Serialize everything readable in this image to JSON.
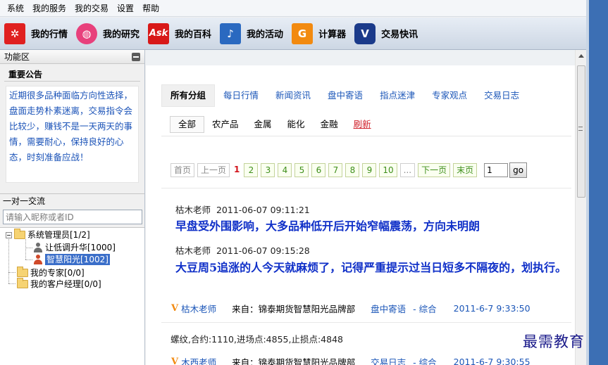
{
  "menu": [
    "系统",
    "我的服务",
    "我的交易",
    "设置",
    "帮助"
  ],
  "toolbar": [
    {
      "label": "我的行情",
      "icon": "flower-icon",
      "glyph": "✲"
    },
    {
      "label": "我的研究",
      "icon": "dribbble-icon",
      "glyph": "◍"
    },
    {
      "label": "我的百科",
      "icon": "ask-icon",
      "glyph": "Ask"
    },
    {
      "label": "我的活动",
      "icon": "music-note-icon",
      "glyph": "♪"
    },
    {
      "label": "计算器",
      "icon": "g-icon",
      "glyph": "G"
    },
    {
      "label": "交易快讯",
      "icon": "v-icon",
      "glyph": "V"
    }
  ],
  "left": {
    "panel_title": "功能区",
    "notice_title": "重要公告",
    "notice_text": "近期很多品种面临方向性选择，盘面走势朴素迷离，交易指令会比较少，赚钱不是一天两天的事情，需要耐心，保持良好的心态，时刻准备应战！",
    "chat_title": "一对一交流",
    "search_placeholder": "请输入昵称或者ID",
    "tree": {
      "admins": "系统管理员[1/2]",
      "user1": "让低调升华[1000]",
      "user2": "智慧阳光[1002]",
      "experts": "我的专家[0/0]",
      "managers": "我的客户经理[0/0]"
    }
  },
  "main": {
    "categories": [
      "所有分组",
      "每日行情",
      "新闻资讯",
      "盘中寄语",
      "指点迷津",
      "专家观点",
      "交易日志"
    ],
    "subcategories": [
      "全部",
      "农产品",
      "金属",
      "能化",
      "金融"
    ],
    "refresh": "刷新",
    "pager": {
      "first": "首页",
      "prev": "上一页",
      "current": "1",
      "pages": [
        "2",
        "3",
        "4",
        "5",
        "6",
        "7",
        "8",
        "9",
        "10",
        "..."
      ],
      "next": "下一页",
      "last": "末页",
      "input_value": "1",
      "go": "go"
    },
    "posts": [
      {
        "author": "枯木老师",
        "time": "2011-06-07 09:11:21",
        "title": "早盘受外围影响，大多品种低开后开始窄幅震荡，方向未明朗"
      },
      {
        "author": "枯木老师",
        "time": "2011-06-07 09:15:28",
        "title": "大豆周5追涨的人今天就麻烦了，记得严重提示过当日短多不隔夜的，划执行。"
      }
    ],
    "info1": {
      "author": "枯木老师",
      "from": "来自：锦泰期货智慧阳光品牌部",
      "category": "盘中寄语",
      "tag": "- 综合",
      "date": "2011-6-7 9:33:50"
    },
    "trade_note": "螺纹,合约:1110,进场点:4855,止损点:4848",
    "info2": {
      "author": "木西老师",
      "from": "来自：锦泰期货智慧阳光品牌部",
      "category": "交易日志",
      "tag": "- 综合",
      "date": "2011-6-7 9:30:55"
    }
  },
  "watermark": "最需教育"
}
